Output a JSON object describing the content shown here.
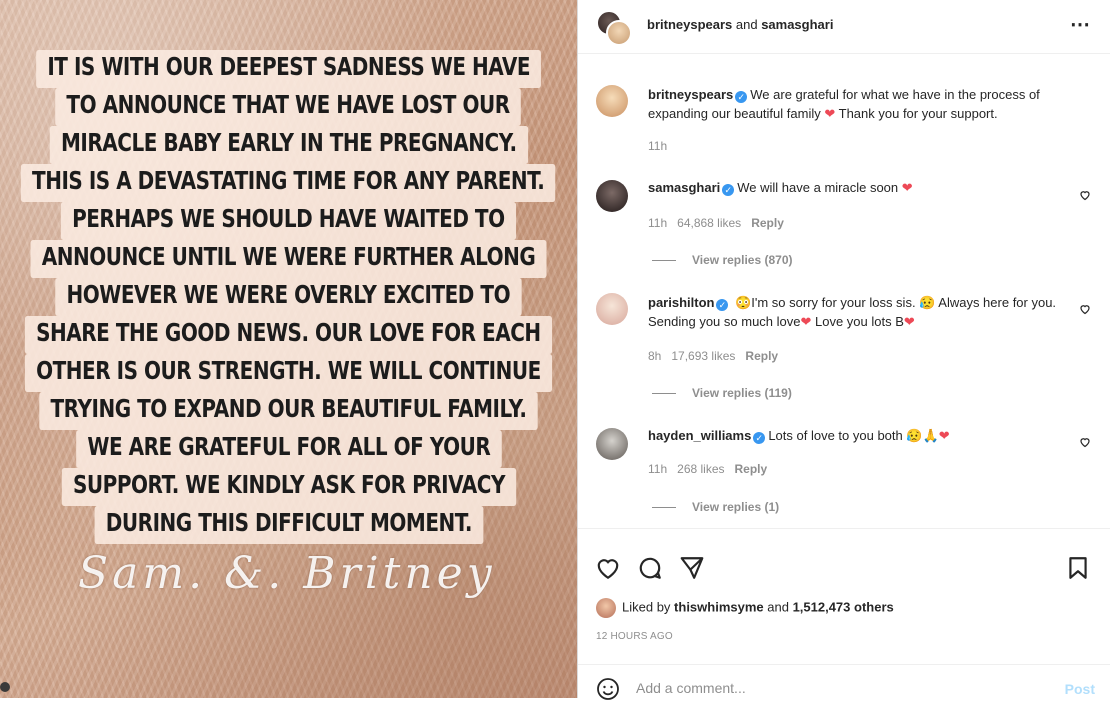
{
  "image": {
    "announcement_lines": [
      "IT IS WITH OUR DEEPEST SADNESS WE HAVE",
      "TO ANNOUNCE THAT WE HAVE LOST OUR",
      "MIRACLE BABY EARLY IN THE PREGNANCY.",
      "THIS IS A DEVASTATING TIME FOR ANY PARENT.",
      "PERHAPS WE SHOULD HAVE WAITED TO",
      "ANNOUNCE UNTIL WE WERE FURTHER ALONG",
      "HOWEVER WE WERE OVERLY EXCITED TO",
      "SHARE THE GOOD NEWS. OUR LOVE FOR EACH",
      "OTHER IS OUR STRENGTH. WE WILL CONTINUE",
      "TRYING TO EXPAND OUR BEAUTIFUL FAMILY.",
      "WE ARE GRATEFUL FOR ALL OF YOUR",
      "SUPPORT.  WE KINDLY ASK FOR PRIVACY",
      "DURING THIS DIFFICULT MOMENT."
    ],
    "signature": "Sam.  &.  Britney"
  },
  "header": {
    "user1": "britneyspears",
    "connector": " and ",
    "user2": "samasghari",
    "more_icon": "more-horizontal-icon"
  },
  "caption": {
    "username": "britneyspears",
    "text_before": "We are grateful for what we have in the process of expanding our beautiful family ",
    "text_after": " Thank you for your support.",
    "time": "11h"
  },
  "comments": [
    {
      "username": "samasghari",
      "text": "We will have a miracle soon",
      "time": "11h",
      "likes": "64,868 likes",
      "reply": "Reply",
      "view_replies": "View replies (870)"
    },
    {
      "username": "parishilton",
      "text": "I'm so sorry for your loss sis.",
      "text2": " Always here for you. Sending you so much love",
      "text3": " Love you lots B",
      "time": "8h",
      "likes": "17,693 likes",
      "reply": "Reply",
      "view_replies": "View replies (119)"
    },
    {
      "username": "hayden_williams",
      "text": "Lots of love to you both",
      "time": "11h",
      "likes": "268 likes",
      "reply": "Reply",
      "view_replies": "View replies (1)"
    }
  ],
  "actions": {
    "like_icon": "heart-outline-icon",
    "comment_icon": "comment-bubble-icon",
    "share_icon": "paper-plane-icon",
    "save_icon": "bookmark-icon"
  },
  "likes_summary": {
    "prefix": "Liked by ",
    "user": "thiswhimsyme",
    "middle": " and ",
    "count": "1,512,473 others"
  },
  "time_ago": "12 HOURS AGO",
  "comment_box": {
    "placeholder": "Add a comment...",
    "post_label": "Post",
    "emoji_icon": "smiley-icon"
  },
  "colors": {
    "verified": "#3897f0",
    "heart_red": "#ed4956",
    "post_disabled": "#b2dffc",
    "muted": "#8e8e8e"
  }
}
